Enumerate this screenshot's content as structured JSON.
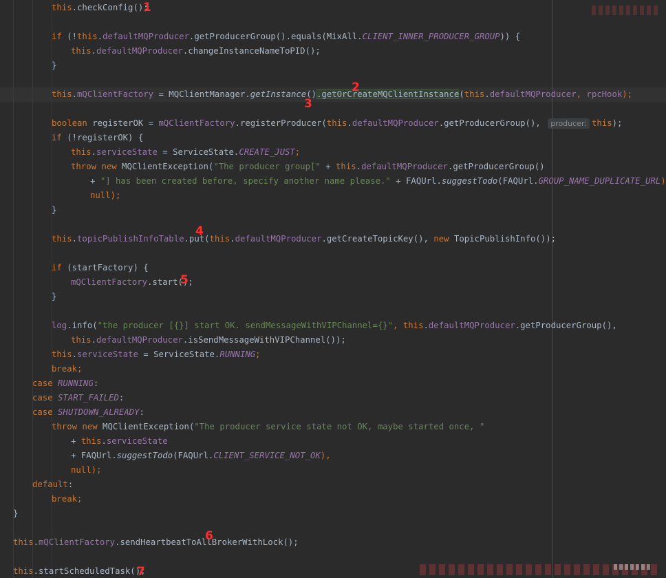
{
  "code": {
    "l_check": [
      "this",
      ".checkConfig();"
    ],
    "l_if1": [
      "if",
      " (!",
      "this",
      ".",
      "defaultMQProducer",
      ".getProducerGroup().equals(MixAll.",
      "CLIENT_INNER_PRODUCER_GROUP",
      ")) {"
    ],
    "l_change": [
      "this",
      ".",
      "defaultMQProducer",
      ".changeInstanceNameToPID();"
    ],
    "l_close1": [
      "}"
    ],
    "l_factory": [
      "this",
      ".",
      "mQClientFactory",
      " = MQClientManager.",
      "getInstance",
      "()",
      ".getOrCreateMQClientInstance",
      "(",
      "this",
      ".",
      "defaultMQProducer",
      ", ",
      "rpcHook",
      ");"
    ],
    "l_boolean": [
      "boolean",
      " registerOK = ",
      "mQClientFactory",
      ".registerProducer(",
      "this",
      ".",
      "defaultMQProducer",
      ".getProducerGroup(), ",
      "producer:",
      "this",
      ");"
    ],
    "l_if2": [
      "if",
      " (!registerOK) {"
    ],
    "l_state": [
      "this",
      ".",
      "serviceState",
      " = ServiceState.",
      "CREATE_JUST",
      ";"
    ],
    "l_throw1": [
      "throw",
      " ",
      "new",
      " MQClientException(",
      "\"The producer group[\"",
      " + ",
      "this",
      ".",
      "defaultMQProducer",
      ".getProducerGroup()"
    ],
    "l_plus1": [
      "+ ",
      "\"] has been created before, specify another name please.\"",
      " + FAQUrl.",
      "suggestTodo",
      "(FAQUrl.",
      "GROUP_NAME_DUPLICATE_URL",
      "),"
    ],
    "l_null1": [
      "null",
      ");"
    ],
    "l_close2": [
      "}"
    ],
    "l_put": [
      "this",
      ".",
      "topicPublishInfoTable",
      ".put(",
      "this",
      ".",
      "defaultMQProducer",
      ".getCreateTopicKey(), ",
      "new",
      " TopicPublishInfo());"
    ],
    "l_if3": [
      "if",
      " (startFactory) {"
    ],
    "l_start": [
      "mQClientFactory",
      ".start();"
    ],
    "l_close3": [
      "}"
    ],
    "l_log": [
      "log",
      ".info(",
      "\"the producer [{}] start OK. sendMessageWithVIPChannel={}\"",
      ", ",
      "this",
      ".",
      "defaultMQProducer",
      ".getProducerGroup(),"
    ],
    "l_vip": [
      "this",
      ".",
      "defaultMQProducer",
      ".isSendMessageWithVIPChannel());"
    ],
    "l_state2": [
      "this",
      ".",
      "serviceState",
      " = ServiceState.",
      "RUNNING",
      ";"
    ],
    "l_break1": [
      "break",
      ";"
    ],
    "l_case1": [
      "case",
      " ",
      "RUNNING",
      ":"
    ],
    "l_case2": [
      "case",
      " ",
      "START_FAILED",
      ":"
    ],
    "l_case3": [
      "case",
      " ",
      "SHUTDOWN_ALREADY",
      ":"
    ],
    "l_throw2": [
      "throw",
      " ",
      "new",
      " MQClientException(",
      "\"The producer service state not OK, maybe started once, \""
    ],
    "l_plus2": [
      "+ ",
      "this",
      ".",
      "serviceState"
    ],
    "l_plus3": [
      "+ FAQUrl.",
      "suggestTodo",
      "(FAQUrl.",
      "CLIENT_SERVICE_NOT_OK",
      "),"
    ],
    "l_null2": [
      "null",
      ");"
    ],
    "l_default": [
      "default",
      ":"
    ],
    "l_break2": [
      "break",
      ";"
    ],
    "l_close4": [
      "}"
    ],
    "l_heart": [
      "this",
      ".",
      "mQClientFactory",
      ".sendHeartbeatToAllBrokerWithLock();"
    ],
    "l_sched": [
      "this",
      ".startScheduledTask();"
    ]
  },
  "markers": [
    "1",
    "2",
    "3",
    "4",
    "5",
    "6",
    "7"
  ],
  "colors": {
    "background": "#2b2b2b",
    "keyword": "#cc7832",
    "field": "#9876aa",
    "string": "#6a8759",
    "text": "#a9b7c6",
    "marker": "#ff2d2d"
  }
}
